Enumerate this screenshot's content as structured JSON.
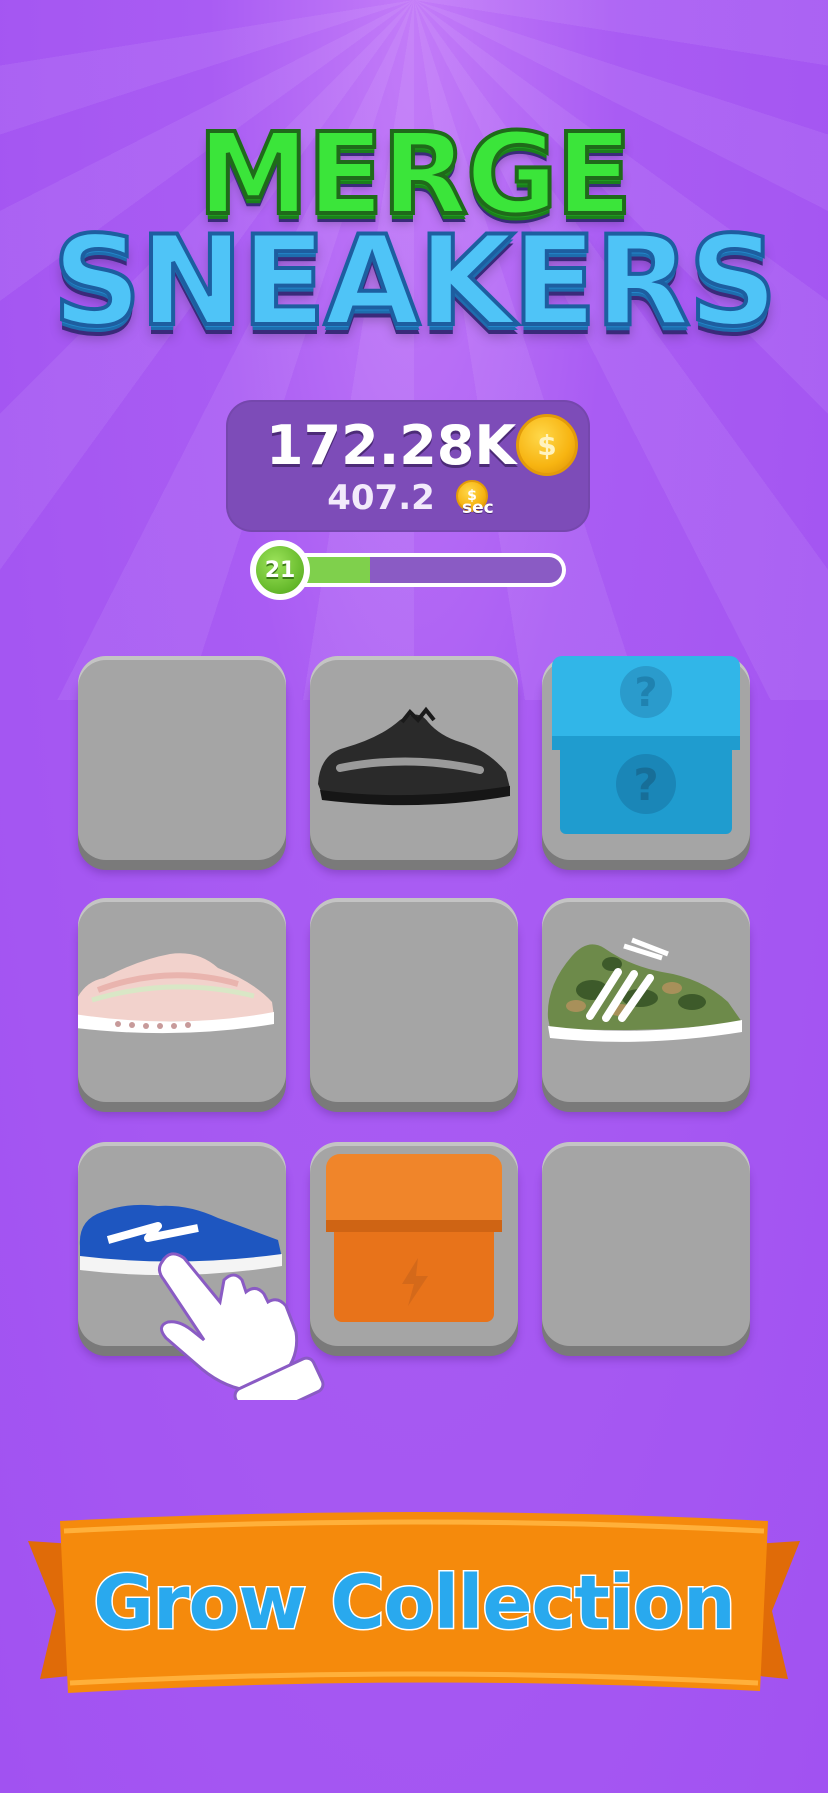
{
  "title": {
    "line1": "MERGE",
    "line2": "SNEAKERS"
  },
  "money": {
    "total": "172.28K",
    "coin_symbol": "$",
    "rate": "407.2",
    "rate_unit": "sec"
  },
  "level": {
    "number": "21",
    "progress": 0.31
  },
  "grid": {
    "rows": 3,
    "cols": 3,
    "tiles": [
      {
        "content": "empty"
      },
      {
        "content": "black-sneaker-icon"
      },
      {
        "content": "blue-mystery-box-icon"
      },
      {
        "content": "pink-sneaker-icon"
      },
      {
        "content": "empty"
      },
      {
        "content": "camo-sneaker-icon"
      },
      {
        "content": "blue-skate-sneaker-icon"
      },
      {
        "content": "orange-lightning-box-icon"
      },
      {
        "content": "empty"
      }
    ]
  },
  "hint": {
    "icon": "pointing-hand-icon"
  },
  "banner": {
    "label": "Grow Collection"
  },
  "colors": {
    "background": "#a95cf3",
    "title_green": "#3be53a",
    "title_blue": "#4fc4f7",
    "panel": "#7d4cb8",
    "tile": "#a5a5a5",
    "banner_orange": "#f58a0c",
    "banner_text": "#29a9ee"
  }
}
